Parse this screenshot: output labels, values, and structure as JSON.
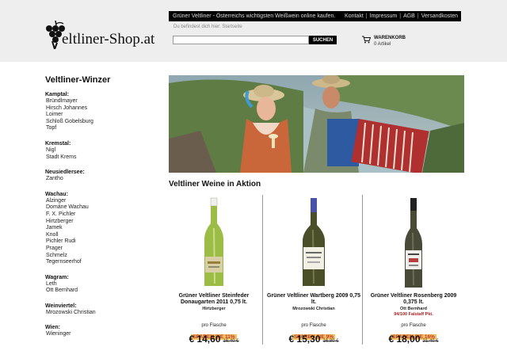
{
  "header": {
    "logo_text": "eltliner-Shop.at",
    "tagline": "Grüner Veltliner - Österreichs wichtigsten Weißwein online kaufen.",
    "links": [
      "Kontakt",
      "Impressum",
      "AGB",
      "Versandkosten"
    ],
    "breadcrumb": "Du befindest dich hier: Startseite",
    "search_button": "SUCHEN",
    "search_value": "",
    "cart_title": "WARENKORB",
    "cart_count": "0 Artikel"
  },
  "sidebar": {
    "title": "Veltliner-Winzer",
    "regions": [
      {
        "name": "Kamptal:",
        "wineries": [
          "Bründlmayer",
          "Hirsch Johannes",
          "Loimer",
          "Schloß Gobelsburg",
          "Topf"
        ]
      },
      {
        "name": "Kremstal:",
        "wineries": [
          "Nigl",
          "Stadt Krems"
        ]
      },
      {
        "name": "Neusiedlersee:",
        "wineries": [
          "Zantho"
        ]
      },
      {
        "name": "Wachau:",
        "wineries": [
          "Alzinger",
          "Domäne Wachau",
          "F. X. Pichler",
          "Hirtzberger",
          "Jamek",
          "Knoll",
          "Pichler Rudi",
          "Prager",
          "Schmelz",
          "Tegernseerhof"
        ]
      },
      {
        "name": "Wagram:",
        "wineries": [
          "Leth",
          "Ott Bernhard"
        ]
      },
      {
        "name": "Weinviertel:",
        "wineries": [
          "Mrozowski Christian"
        ]
      },
      {
        "name": "Wien:",
        "wineries": [
          "Wieninger"
        ]
      }
    ]
  },
  "main": {
    "section_title": "Veltliner Weine in Aktion",
    "products": [
      {
        "name": "Grüner Veltliner Steinfeder Donaugarten 2011 0,75 lt.",
        "producer": "Hirtzberger",
        "extra": "",
        "per_bottle": "pro Flasche",
        "save": "SPAREN SIE 11%",
        "price": "€ 14,60",
        "old_price": "16,40 €"
      },
      {
        "name": "Grüner Veltliner Wartberg 2009 0,75 lt.",
        "producer": "Mrozowski Christian",
        "extra": "",
        "per_bottle": "pro Flasche",
        "save": "SPAREN SIE 9%",
        "price": "€ 15,30",
        "old_price": "16,80 €"
      },
      {
        "name": "Grüner Veltliner Rosenberg 2009 0,375 lt.",
        "producer": "Ott Bernhard",
        "extra": "94/100 Falstaff Pkt.",
        "per_bottle": "pro Flasche",
        "save": "SPAREN SIE 16%",
        "price": "€ 18,00",
        "old_price": "21,40 €"
      }
    ]
  },
  "colors": {
    "header_bg": "#eeeeee",
    "topbar_bg": "#000000",
    "save_badge_bg": "#f3c062",
    "save_badge_text": "#c0392b",
    "award_text": "#b02020"
  }
}
